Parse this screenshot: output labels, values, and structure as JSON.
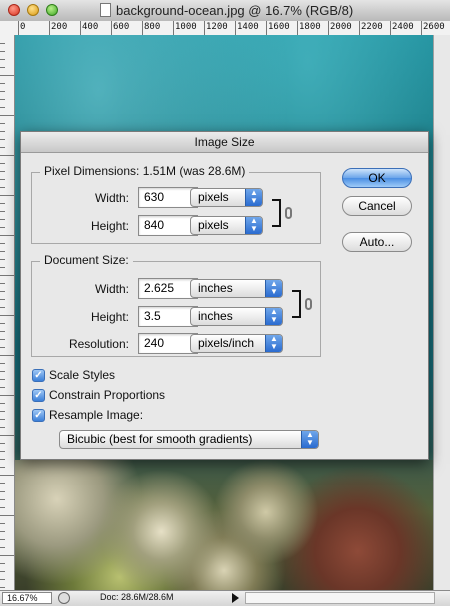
{
  "window": {
    "title": "background-ocean.jpg @ 16.7% (RGB/8)"
  },
  "ruler": {
    "top_labels": [
      "0",
      "200",
      "400",
      "600",
      "800",
      "1000",
      "1200",
      "1400",
      "1600",
      "1800",
      "2000",
      "2200",
      "2400",
      "2600"
    ]
  },
  "status": {
    "zoom": "16.67%",
    "doc_info": "Doc: 28.6M/28.6M"
  },
  "dialog": {
    "title": "Image Size",
    "pixel_dimensions": {
      "legend": "Pixel Dimensions:  1.51M (was 28.6M)",
      "width_label": "Width:",
      "width_value": "630",
      "width_unit": "pixels",
      "height_label": "Height:",
      "height_value": "840",
      "height_unit": "pixels"
    },
    "document_size": {
      "legend": "Document Size:",
      "width_label": "Width:",
      "width_value": "2.625",
      "width_unit": "inches",
      "height_label": "Height:",
      "height_value": "3.5",
      "height_unit": "inches",
      "resolution_label": "Resolution:",
      "resolution_value": "240",
      "resolution_unit": "pixels/inch"
    },
    "buttons": {
      "ok": "OK",
      "cancel": "Cancel",
      "auto": "Auto..."
    },
    "options": {
      "scale_styles": {
        "label": "Scale Styles",
        "checked": true
      },
      "constrain_proportions": {
        "label": "Constrain Proportions",
        "checked": true
      },
      "resample_image": {
        "label": "Resample Image:",
        "checked": true
      }
    },
    "resample_method": "Bicubic (best for smooth gradients)"
  },
  "colors": {
    "default_button": "#4a8ee3",
    "checkbox": "#3b7fd8"
  }
}
